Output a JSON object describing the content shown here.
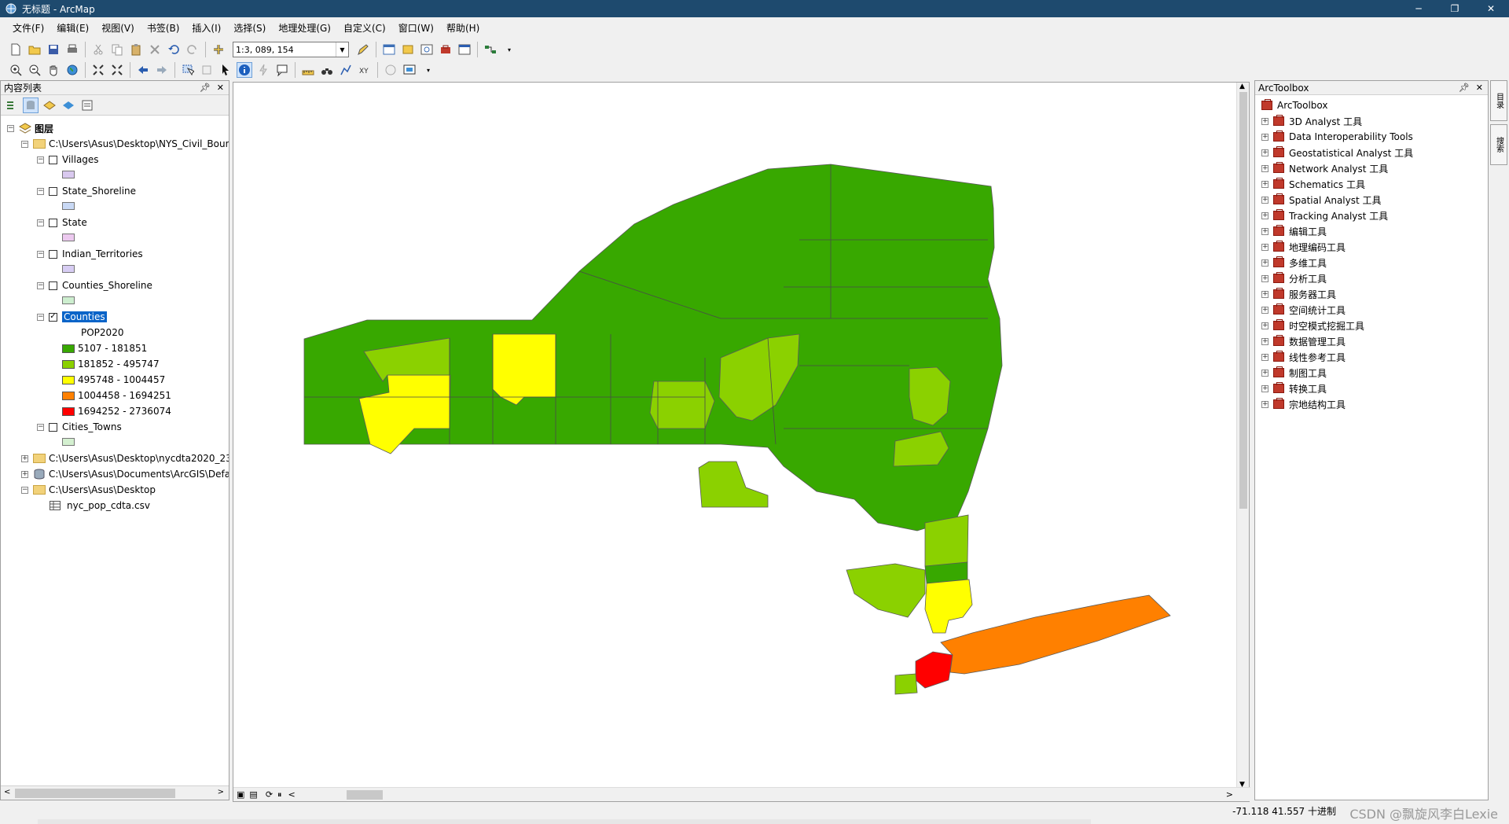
{
  "window": {
    "title": "无标题 - ArcMap",
    "min": "─",
    "max": "❐",
    "close": "✕"
  },
  "menu": [
    "文件(F)",
    "编辑(E)",
    "视图(V)",
    "书签(B)",
    "插入(I)",
    "选择(S)",
    "地理处理(G)",
    "自定义(C)",
    "窗口(W)",
    "帮助(H)"
  ],
  "toolbar": {
    "scale": "1:3, 089, 154"
  },
  "toc": {
    "title": "内容列表",
    "layers_root": "图层",
    "group1": "C:\\Users\\Asus\\Desktop\\NYS_Civil_Boun",
    "layers": [
      {
        "name": "Villages",
        "checked": false,
        "swatch": "#d9c9ef"
      },
      {
        "name": "State_Shoreline",
        "checked": false,
        "swatch": "#c9d9f5"
      },
      {
        "name": "State",
        "checked": false,
        "swatch": "#ecc9ef"
      },
      {
        "name": "Indian_Territories",
        "checked": false,
        "swatch": "#d7cdf3"
      },
      {
        "name": "Counties_Shoreline",
        "checked": false,
        "swatch": "#cdeecf"
      }
    ],
    "counties": {
      "name": "Counties",
      "field": "POP2020",
      "classes": [
        {
          "label": "5107 - 181851",
          "color": "#38a800"
        },
        {
          "label": "181852 - 495747",
          "color": "#8bd100"
        },
        {
          "label": "495748 - 1004457",
          "color": "#ffff00"
        },
        {
          "label": "1004458 - 1694251",
          "color": "#ff8000"
        },
        {
          "label": "1694252 - 2736074",
          "color": "#ff0000"
        }
      ]
    },
    "cities": {
      "name": "Cities_Towns",
      "swatch": "#d4f0d0"
    },
    "group2": "C:\\Users\\Asus\\Desktop\\nycdta2020_23",
    "group3": "C:\\Users\\Asus\\Documents\\ArcGIS\\Defa",
    "group4": "C:\\Users\\Asus\\Desktop",
    "table": "nyc_pop_cdta.csv"
  },
  "toolbox": {
    "title": "ArcToolbox",
    "root": "ArcToolbox",
    "items": [
      "3D Analyst 工具",
      "Data Interoperability Tools",
      "Geostatistical Analyst 工具",
      "Network Analyst 工具",
      "Schematics 工具",
      "Spatial Analyst 工具",
      "Tracking Analyst 工具",
      "编辑工具",
      "地理编码工具",
      "多维工具",
      "分析工具",
      "服务器工具",
      "空间统计工具",
      "时空模式挖掘工具",
      "数据管理工具",
      "线性参考工具",
      "制图工具",
      "转换工具",
      "宗地结构工具"
    ]
  },
  "side_tabs": [
    "目录",
    "搜索"
  ],
  "status": {
    "coords": "-71.118  41.557 十进制",
    "watermark": "CSDN @飘旋风李白Lexie"
  }
}
